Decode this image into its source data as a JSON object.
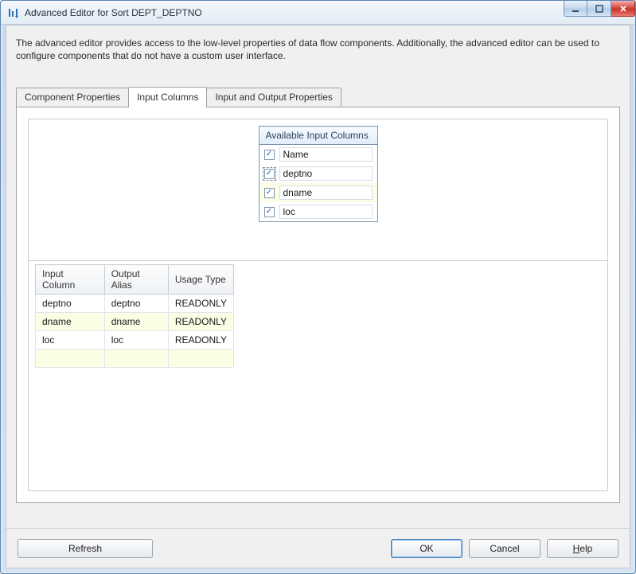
{
  "window": {
    "title": "Advanced Editor for Sort DEPT_DEPTNO"
  },
  "intro": "The advanced editor provides access to the low-level properties of data flow components. Additionally, the advanced editor can be used to configure components that do not have a custom user interface.",
  "tabs": [
    {
      "label": "Component Properties",
      "active": false
    },
    {
      "label": "Input Columns",
      "active": true
    },
    {
      "label": "Input and Output Properties",
      "active": false
    }
  ],
  "available_columns": {
    "header": "Available Input Columns",
    "items": [
      {
        "label": "Name",
        "checked": true,
        "highlight": false,
        "dashed": false
      },
      {
        "label": "deptno",
        "checked": true,
        "highlight": false,
        "dashed": true
      },
      {
        "label": "dname",
        "checked": true,
        "highlight": true,
        "dashed": false
      },
      {
        "label": "loc",
        "checked": true,
        "highlight": false,
        "dashed": false
      }
    ]
  },
  "io_table": {
    "headers": [
      "Input Column",
      "Output Alias",
      "Usage Type"
    ],
    "rows": [
      {
        "cells": [
          "deptno",
          "deptno",
          "READONLY"
        ],
        "highlight": false
      },
      {
        "cells": [
          "dname",
          "dname",
          "READONLY"
        ],
        "highlight": true
      },
      {
        "cells": [
          "loc",
          "loc",
          "READONLY"
        ],
        "highlight": false
      },
      {
        "cells": [
          "",
          "",
          ""
        ],
        "highlight": true
      }
    ]
  },
  "buttons": {
    "refresh": "Refresh",
    "ok": "OK",
    "cancel": "Cancel",
    "help": "Help"
  }
}
